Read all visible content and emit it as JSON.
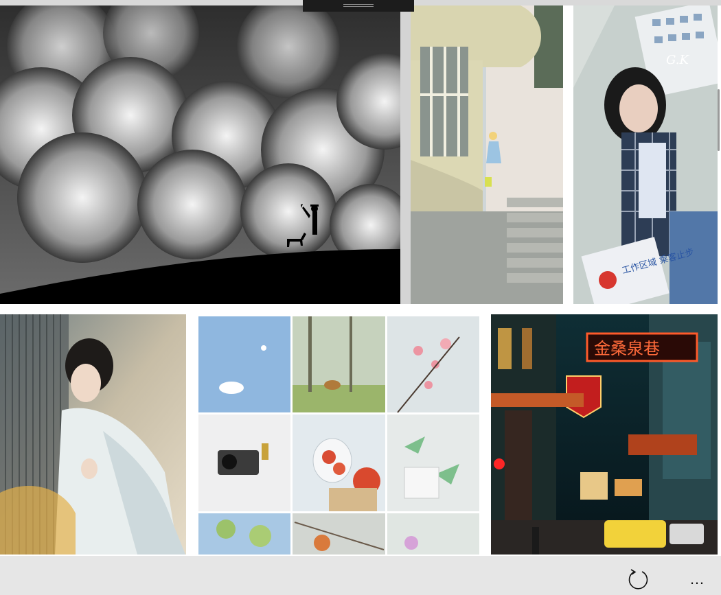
{
  "gallery": {
    "photos": [
      {
        "id": "clouds",
        "subject": "black and white clouds with silhouette of man and dog on hill"
      },
      {
        "id": "building",
        "subject": "girl on stairs of curved building"
      },
      {
        "id": "plaid-girl",
        "subject": "girl in plaid shirt by wall",
        "watermark": "G.K",
        "sign_text": "工作区域 乘客止步"
      },
      {
        "id": "hanfu-girl",
        "subject": "woman in white traditional dress behind bamboo blind"
      },
      {
        "id": "collage",
        "subject": "3x3 collage: sky, deer, blossoms, camera, tomatoes, paper planes, branches"
      },
      {
        "id": "neon-street",
        "subject": "neon street at night",
        "neon_sign": "金桑泉巷"
      }
    ]
  },
  "toolbar": {
    "refresh_icon": "refresh-icon",
    "more_label": "…"
  }
}
